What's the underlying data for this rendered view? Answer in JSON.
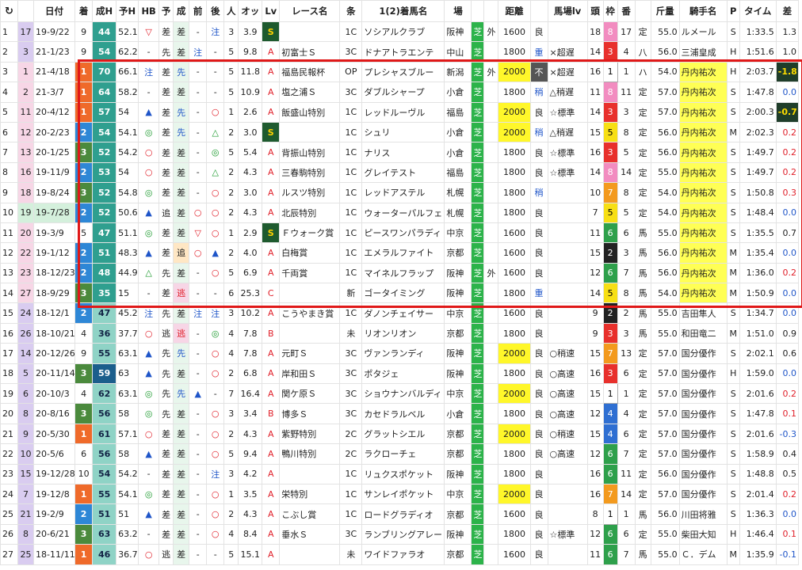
{
  "headers": [
    "↻",
    "",
    "日付",
    "着",
    "成H",
    "予H",
    "HB",
    "予",
    "成",
    "前",
    "後",
    "人",
    "オッ",
    "Lv",
    "レース名",
    "条",
    "1(2)着馬名",
    "場",
    "",
    "",
    "距離",
    "",
    "馬場lv",
    "頭",
    "枠",
    "番",
    "",
    "斤量",
    "騎手名",
    "P",
    "タイム",
    "差"
  ],
  "header_icon": "refresh-icon",
  "rows": [
    {
      "no": "1",
      "rank": "17",
      "date": "19-9/22",
      "fin": "9",
      "sh": "44",
      "yh": "52.1",
      "hb": "▽",
      "yo": "差",
      "sei": "差",
      "mae": "-",
      "ato": "注",
      "pop": "3",
      "odds": "3.9",
      "lv": "S",
      "race": "",
      "cond": "1C",
      "horse": "ソシアルクラブ",
      "place": "阪神",
      "surf": "芝",
      "io": "外",
      "dist": "1600",
      "going": "良",
      "glv": "",
      "heads": "18",
      "waku": "8",
      "ban": "17",
      "sex": "定",
      "kin": "55.0",
      "jockey": "ルメール",
      "p": "S",
      "time": "1:33.5",
      "diff": "1.3"
    },
    {
      "no": "2",
      "rank": "3",
      "date": "21-1/23",
      "fin": "9",
      "sh": "54",
      "yh": "62.2",
      "hb": "-",
      "yo": "先",
      "sei": "差",
      "mae": "注",
      "ato": "-",
      "pop": "5",
      "odds": "9.8",
      "lv": "A",
      "race": "初富士Ｓ",
      "cond": "3C",
      "horse": "ドナアトラエンテ",
      "place": "中山",
      "surf": "芝",
      "io": "",
      "dist": "1800",
      "going": "重",
      "glv": "×超遅",
      "heads": "14",
      "waku": "3",
      "ban": "4",
      "sex": "八",
      "kin": "56.0",
      "jockey": "三浦皇成",
      "p": "H",
      "time": "1:51.6",
      "diff": "1.0"
    },
    {
      "no": "3",
      "rank": "1",
      "date": "21-4/18",
      "fin": "1",
      "sh": "70",
      "yh": "66.1",
      "hb": "注",
      "yo": "差",
      "sei": "先",
      "mae": "-",
      "ato": "-",
      "pop": "5",
      "odds": "11.8",
      "lv": "A",
      "race": "福島民報杯",
      "cond": "OP",
      "horse": "プレシャスブルー",
      "place": "新潟",
      "surf": "芝",
      "io": "外",
      "dist": "2000",
      "going": "不",
      "glv": "×超遅",
      "heads": "16",
      "waku": "1",
      "ban": "1",
      "sex": "ハ",
      "kin": "54.0",
      "jockey": "丹内祐次",
      "p": "H",
      "time": "2:03.7",
      "diff": "-1.8"
    },
    {
      "no": "4",
      "rank": "2",
      "date": "21-3/7",
      "fin": "1",
      "sh": "64",
      "yh": "58.2",
      "hb": "-",
      "yo": "差",
      "sei": "差",
      "mae": "-",
      "ato": "-",
      "pop": "5",
      "odds": "10.9",
      "lv": "A",
      "race": "塩之浦Ｓ",
      "cond": "3C",
      "horse": "ダブルシャープ",
      "place": "小倉",
      "surf": "芝",
      "io": "",
      "dist": "1800",
      "going": "稍",
      "glv": "△稍遅",
      "heads": "11",
      "waku": "8",
      "ban": "11",
      "sex": "定",
      "kin": "57.0",
      "jockey": "丹内祐次",
      "p": "S",
      "time": "1:47.8",
      "diff": "0.0"
    },
    {
      "no": "5",
      "rank": "11",
      "date": "20-4/12",
      "fin": "1",
      "sh": "57",
      "yh": "54",
      "hb": "▲",
      "yo": "差",
      "sei": "先",
      "mae": "-",
      "ato": "○",
      "pop": "1",
      "odds": "2.6",
      "lv": "A",
      "race": "飯盛山特別",
      "cond": "1C",
      "horse": "レッドルーヴル",
      "place": "福島",
      "surf": "芝",
      "io": "",
      "dist": "2000",
      "going": "良",
      "glv": "☆標準",
      "heads": "14",
      "waku": "3",
      "ban": "3",
      "sex": "定",
      "kin": "57.0",
      "jockey": "丹内祐次",
      "p": "S",
      "time": "2:00.3",
      "diff": "-0.7"
    },
    {
      "no": "6",
      "rank": "12",
      "date": "20-2/23",
      "fin": "2",
      "sh": "54",
      "yh": "54.1",
      "hb": "◎",
      "yo": "差",
      "sei": "先",
      "mae": "-",
      "ato": "△",
      "pop": "2",
      "odds": "3.0",
      "lv": "S",
      "race": "",
      "cond": "1C",
      "horse": "シュリ",
      "place": "小倉",
      "surf": "芝",
      "io": "",
      "dist": "2000",
      "going": "稍",
      "glv": "△稍遅",
      "heads": "15",
      "waku": "5",
      "ban": "8",
      "sex": "定",
      "kin": "56.0",
      "jockey": "丹内祐次",
      "p": "M",
      "time": "2:02.3",
      "diff": "0.2"
    },
    {
      "no": "7",
      "rank": "13",
      "date": "20-1/25",
      "fin": "3",
      "sh": "52",
      "yh": "54.2",
      "hb": "○",
      "yo": "差",
      "sei": "差",
      "mae": "-",
      "ato": "◎",
      "pop": "5",
      "odds": "5.4",
      "lv": "A",
      "race": "背振山特別",
      "cond": "1C",
      "horse": "ナリス",
      "place": "小倉",
      "surf": "芝",
      "io": "",
      "dist": "1800",
      "going": "良",
      "glv": "☆標準",
      "heads": "16",
      "waku": "3",
      "ban": "5",
      "sex": "定",
      "kin": "56.0",
      "jockey": "丹内祐次",
      "p": "S",
      "time": "1:49.7",
      "diff": "0.2"
    },
    {
      "no": "8",
      "rank": "16",
      "date": "19-11/9",
      "fin": "2",
      "sh": "53",
      "yh": "54",
      "hb": "○",
      "yo": "差",
      "sei": "差",
      "mae": "-",
      "ato": "△",
      "pop": "2",
      "odds": "4.3",
      "lv": "A",
      "race": "三春駒特別",
      "cond": "1C",
      "horse": "グレイテスト",
      "place": "福島",
      "surf": "芝",
      "io": "",
      "dist": "1800",
      "going": "良",
      "glv": "☆標準",
      "heads": "14",
      "waku": "8",
      "ban": "14",
      "sex": "定",
      "kin": "55.0",
      "jockey": "丹内祐次",
      "p": "S",
      "time": "1:49.7",
      "diff": "0.2"
    },
    {
      "no": "9",
      "rank": "18",
      "date": "19-8/24",
      "fin": "3",
      "sh": "52",
      "yh": "54.8",
      "hb": "◎",
      "yo": "差",
      "sei": "差",
      "mae": "-",
      "ato": "○",
      "pop": "2",
      "odds": "3.0",
      "lv": "A",
      "race": "ルスツ特別",
      "cond": "1C",
      "horse": "レッドアステル",
      "place": "札幌",
      "surf": "芝",
      "io": "",
      "dist": "1800",
      "going": "稍",
      "glv": "",
      "heads": "10",
      "waku": "7",
      "ban": "8",
      "sex": "定",
      "kin": "54.0",
      "jockey": "丹内祐次",
      "p": "S",
      "time": "1:50.8",
      "diff": "0.3"
    },
    {
      "no": "10",
      "rank": "19",
      "date": "19-7/28",
      "fin": "2",
      "sh": "52",
      "yh": "50.6",
      "hb": "▲",
      "yo": "追",
      "sei": "差",
      "mae": "○",
      "ato": "○",
      "pop": "2",
      "odds": "4.3",
      "lv": "A",
      "race": "北辰特別",
      "cond": "1C",
      "horse": "ウォーターパルフェ",
      "place": "札幌",
      "surf": "芝",
      "io": "",
      "dist": "1800",
      "going": "良",
      "glv": "",
      "heads": "7",
      "waku": "5",
      "ban": "5",
      "sex": "定",
      "kin": "54.0",
      "jockey": "丹内祐次",
      "p": "S",
      "time": "1:48.4",
      "diff": "0.0"
    },
    {
      "no": "11",
      "rank": "20",
      "date": "19-3/9",
      "fin": "5",
      "sh": "47",
      "yh": "51.1",
      "hb": "◎",
      "yo": "差",
      "sei": "差",
      "mae": "▽",
      "ato": "○",
      "pop": "1",
      "odds": "2.9",
      "lv": "S",
      "race": "Ｆウォーク賞",
      "cond": "1C",
      "horse": "ピースワンパラディ",
      "place": "中京",
      "surf": "芝",
      "io": "",
      "dist": "1600",
      "going": "良",
      "glv": "",
      "heads": "11",
      "waku": "6",
      "ban": "6",
      "sex": "馬",
      "kin": "55.0",
      "jockey": "丹内祐次",
      "p": "S",
      "time": "1:35.5",
      "diff": "0.7"
    },
    {
      "no": "12",
      "rank": "22",
      "date": "19-1/12",
      "fin": "2",
      "sh": "51",
      "yh": "48.3",
      "hb": "▲",
      "yo": "差",
      "sei": "追",
      "mae": "○",
      "ato": "▲",
      "pop": "2",
      "odds": "4.0",
      "lv": "A",
      "race": "白梅賞",
      "cond": "1C",
      "horse": "エメラルファイト",
      "place": "京都",
      "surf": "芝",
      "io": "",
      "dist": "1600",
      "going": "良",
      "glv": "",
      "heads": "15",
      "waku": "2",
      "ban": "3",
      "sex": "馬",
      "kin": "56.0",
      "jockey": "丹内祐次",
      "p": "M",
      "time": "1:35.4",
      "diff": "0.0"
    },
    {
      "no": "13",
      "rank": "23",
      "date": "18-12/23",
      "fin": "2",
      "sh": "48",
      "yh": "44.9",
      "hb": "△",
      "yo": "先",
      "sei": "差",
      "mae": "-",
      "ato": "○",
      "pop": "5",
      "odds": "6.9",
      "lv": "A",
      "race": "千両賞",
      "cond": "1C",
      "horse": "マイネルフラップ",
      "place": "阪神",
      "surf": "芝",
      "io": "外",
      "dist": "1600",
      "going": "良",
      "glv": "",
      "heads": "12",
      "waku": "6",
      "ban": "7",
      "sex": "馬",
      "kin": "56.0",
      "jockey": "丹内祐次",
      "p": "M",
      "time": "1:36.0",
      "diff": "0.2"
    },
    {
      "no": "14",
      "rank": "27",
      "date": "18-9/29",
      "fin": "3",
      "sh": "35",
      "yh": "15",
      "hb": "-",
      "yo": "差",
      "sei": "逃",
      "mae": "-",
      "ato": "-",
      "pop": "6",
      "odds": "25.3",
      "lv": "C",
      "race": "",
      "cond": "新",
      "horse": "ゴータイミング",
      "place": "阪神",
      "surf": "芝",
      "io": "",
      "dist": "1800",
      "going": "重",
      "glv": "",
      "heads": "14",
      "waku": "5",
      "ban": "8",
      "sex": "馬",
      "kin": "54.0",
      "jockey": "丹内祐次",
      "p": "M",
      "time": "1:50.9",
      "diff": "0.0"
    },
    {
      "no": "15",
      "rank": "24",
      "date": "18-12/1",
      "fin": "2",
      "sh": "47",
      "yh": "45.2",
      "hb": "注",
      "yo": "先",
      "sei": "差",
      "mae": "注",
      "ato": "注",
      "pop": "3",
      "odds": "10.2",
      "lv": "A",
      "race": "こうやまき賞",
      "cond": "1C",
      "horse": "ダノンチェイサー",
      "place": "中京",
      "surf": "芝",
      "io": "",
      "dist": "1600",
      "going": "良",
      "glv": "",
      "heads": "9",
      "waku": "2",
      "ban": "2",
      "sex": "馬",
      "kin": "55.0",
      "jockey": "吉田隼人",
      "p": "S",
      "time": "1:34.7",
      "diff": "0.0"
    },
    {
      "no": "16",
      "rank": "26",
      "date": "18-10/21",
      "fin": "4",
      "sh": "36",
      "yh": "37.7",
      "hb": "○",
      "yo": "逃",
      "sei": "逃",
      "mae": "-",
      "ato": "◎",
      "pop": "4",
      "odds": "7.8",
      "lv": "B",
      "race": "",
      "cond": "未",
      "horse": "リオンリオン",
      "place": "京都",
      "surf": "芝",
      "io": "",
      "dist": "1800",
      "going": "良",
      "glv": "",
      "heads": "9",
      "waku": "3",
      "ban": "3",
      "sex": "馬",
      "kin": "55.0",
      "jockey": "和田竜二",
      "p": "M",
      "time": "1:51.0",
      "diff": "0.9"
    },
    {
      "no": "17",
      "rank": "14",
      "date": "20-12/26",
      "fin": "9",
      "sh": "55",
      "yh": "63.1",
      "hb": "▲",
      "yo": "先",
      "sei": "先",
      "mae": "-",
      "ato": "○",
      "pop": "4",
      "odds": "7.8",
      "lv": "A",
      "race": "元町Ｓ",
      "cond": "3C",
      "horse": "ヴァンランディ",
      "place": "阪神",
      "surf": "芝",
      "io": "",
      "dist": "2000",
      "going": "良",
      "glv": "○稍速",
      "heads": "15",
      "waku": "7",
      "ban": "13",
      "sex": "定",
      "kin": "57.0",
      "jockey": "国分優作",
      "p": "S",
      "time": "2:02.1",
      "diff": "0.6"
    },
    {
      "no": "18",
      "rank": "5",
      "date": "20-11/14",
      "fin": "3",
      "sh": "59",
      "yh": "63",
      "hb": "▲",
      "yo": "先",
      "sei": "差",
      "mae": "-",
      "ato": "○",
      "pop": "2",
      "odds": "6.8",
      "lv": "A",
      "race": "岸和田Ｓ",
      "cond": "3C",
      "horse": "ポタジェ",
      "place": "阪神",
      "surf": "芝",
      "io": "",
      "dist": "1800",
      "going": "良",
      "glv": "○高速",
      "heads": "16",
      "waku": "3",
      "ban": "6",
      "sex": "定",
      "kin": "57.0",
      "jockey": "国分優作",
      "p": "H",
      "time": "1:59.0",
      "diff": "0.0"
    },
    {
      "no": "19",
      "rank": "6",
      "date": "20-10/3",
      "fin": "4",
      "sh": "62",
      "yh": "63.1",
      "hb": "◎",
      "yo": "先",
      "sei": "先",
      "mae": "▲",
      "ato": "-",
      "pop": "7",
      "odds": "16.4",
      "lv": "A",
      "race": "関ケ原Ｓ",
      "cond": "3C",
      "horse": "ショウナンバルディ",
      "place": "中京",
      "surf": "芝",
      "io": "",
      "dist": "2000",
      "going": "良",
      "glv": "○高速",
      "heads": "15",
      "waku": "1",
      "ban": "1",
      "sex": "定",
      "kin": "57.0",
      "jockey": "国分優作",
      "p": "S",
      "time": "2:01.6",
      "diff": "0.2"
    },
    {
      "no": "20",
      "rank": "8",
      "date": "20-8/16",
      "fin": "3",
      "sh": "56",
      "yh": "58",
      "hb": "◎",
      "yo": "先",
      "sei": "差",
      "mae": "-",
      "ato": "○",
      "pop": "3",
      "odds": "3.4",
      "lv": "B",
      "race": "博多Ｓ",
      "cond": "3C",
      "horse": "カセドラルベル",
      "place": "小倉",
      "surf": "芝",
      "io": "",
      "dist": "1800",
      "going": "良",
      "glv": "○高速",
      "heads": "12",
      "waku": "4",
      "ban": "4",
      "sex": "定",
      "kin": "57.0",
      "jockey": "国分優作",
      "p": "S",
      "time": "1:47.8",
      "diff": "0.1"
    },
    {
      "no": "21",
      "rank": "9",
      "date": "20-5/30",
      "fin": "1",
      "sh": "61",
      "yh": "57.1",
      "hb": "○",
      "yo": "差",
      "sei": "差",
      "mae": "-",
      "ato": "○",
      "pop": "2",
      "odds": "4.3",
      "lv": "A",
      "race": "紫野特別",
      "cond": "2C",
      "horse": "グラットシエル",
      "place": "京都",
      "surf": "芝",
      "io": "",
      "dist": "2000",
      "going": "良",
      "glv": "○稍速",
      "heads": "15",
      "waku": "4",
      "ban": "6",
      "sex": "定",
      "kin": "57.0",
      "jockey": "国分優作",
      "p": "S",
      "time": "2:01.6",
      "diff": "-0.3"
    },
    {
      "no": "22",
      "rank": "10",
      "date": "20-5/6",
      "fin": "6",
      "sh": "56",
      "yh": "58",
      "hb": "▲",
      "yo": "差",
      "sei": "差",
      "mae": "-",
      "ato": "○",
      "pop": "5",
      "odds": "9.4",
      "lv": "A",
      "race": "鴨川特別",
      "cond": "2C",
      "horse": "ラクローチェ",
      "place": "京都",
      "surf": "芝",
      "io": "",
      "dist": "1800",
      "going": "良",
      "glv": "○高速",
      "heads": "12",
      "waku": "6",
      "ban": "7",
      "sex": "定",
      "kin": "57.0",
      "jockey": "国分優作",
      "p": "S",
      "time": "1:58.9",
      "diff": "0.4"
    },
    {
      "no": "23",
      "rank": "15",
      "date": "19-12/28",
      "fin": "10",
      "sh": "54",
      "yh": "54.2",
      "hb": "-",
      "yo": "差",
      "sei": "差",
      "mae": "-",
      "ato": "注",
      "pop": "3",
      "odds": "4.2",
      "lv": "A",
      "race": "",
      "cond": "1C",
      "horse": "リュクスポケット",
      "place": "阪神",
      "surf": "芝",
      "io": "",
      "dist": "1800",
      "going": "良",
      "glv": "",
      "heads": "16",
      "waku": "6",
      "ban": "11",
      "sex": "定",
      "kin": "56.0",
      "jockey": "国分優作",
      "p": "S",
      "time": "1:48.8",
      "diff": "0.5"
    },
    {
      "no": "24",
      "rank": "7",
      "date": "19-12/8",
      "fin": "1",
      "sh": "55",
      "yh": "54.1",
      "hb": "◎",
      "yo": "差",
      "sei": "差",
      "mae": "-",
      "ato": "○",
      "pop": "1",
      "odds": "3.5",
      "lv": "A",
      "race": "栄特別",
      "cond": "1C",
      "horse": "サンレイポケット",
      "place": "中京",
      "surf": "芝",
      "io": "",
      "dist": "2000",
      "going": "良",
      "glv": "",
      "heads": "16",
      "waku": "7",
      "ban": "14",
      "sex": "定",
      "kin": "57.0",
      "jockey": "国分優作",
      "p": "S",
      "time": "2:01.4",
      "diff": "0.2"
    },
    {
      "no": "25",
      "rank": "21",
      "date": "19-2/9",
      "fin": "2",
      "sh": "51",
      "yh": "51",
      "hb": "▲",
      "yo": "差",
      "sei": "差",
      "mae": "-",
      "ato": "○",
      "pop": "2",
      "odds": "4.3",
      "lv": "A",
      "race": "こぶし賞",
      "cond": "1C",
      "horse": "ロードグラディオ",
      "place": "京都",
      "surf": "芝",
      "io": "",
      "dist": "1600",
      "going": "良",
      "glv": "",
      "heads": "8",
      "waku": "1",
      "ban": "1",
      "sex": "馬",
      "kin": "56.0",
      "jockey": "川田将雅",
      "p": "S",
      "time": "1:36.3",
      "diff": "0.0"
    },
    {
      "no": "26",
      "rank": "8",
      "date": "20-6/21",
      "fin": "3",
      "sh": "63",
      "yh": "63.2",
      "hb": "-",
      "yo": "差",
      "sei": "差",
      "mae": "-",
      "ato": "○",
      "pop": "4",
      "odds": "8.4",
      "lv": "A",
      "race": "垂水Ｓ",
      "cond": "3C",
      "horse": "ランブリングアレー",
      "place": "阪神",
      "surf": "芝",
      "io": "",
      "dist": "1800",
      "going": "良",
      "glv": "☆標準",
      "heads": "12",
      "waku": "6",
      "ban": "6",
      "sex": "定",
      "kin": "55.0",
      "jockey": "柴田大知",
      "p": "H",
      "time": "1:46.4",
      "diff": "0.1"
    },
    {
      "no": "27",
      "rank": "25",
      "date": "18-11/11",
      "fin": "1",
      "sh": "46",
      "yh": "36.7",
      "hb": "○",
      "yo": "逃",
      "sei": "差",
      "mae": "-",
      "ato": "-",
      "pop": "5",
      "odds": "15.1",
      "lv": "A",
      "race": "",
      "cond": "未",
      "horse": "ワイドファラオ",
      "place": "京都",
      "surf": "芝",
      "io": "",
      "dist": "1600",
      "going": "良",
      "glv": "",
      "heads": "11",
      "waku": "6",
      "ban": "7",
      "sex": "馬",
      "kin": "55.0",
      "jockey": "Ｃ．デム",
      "p": "M",
      "time": "1:35.9",
      "diff": "-0.1"
    }
  ]
}
